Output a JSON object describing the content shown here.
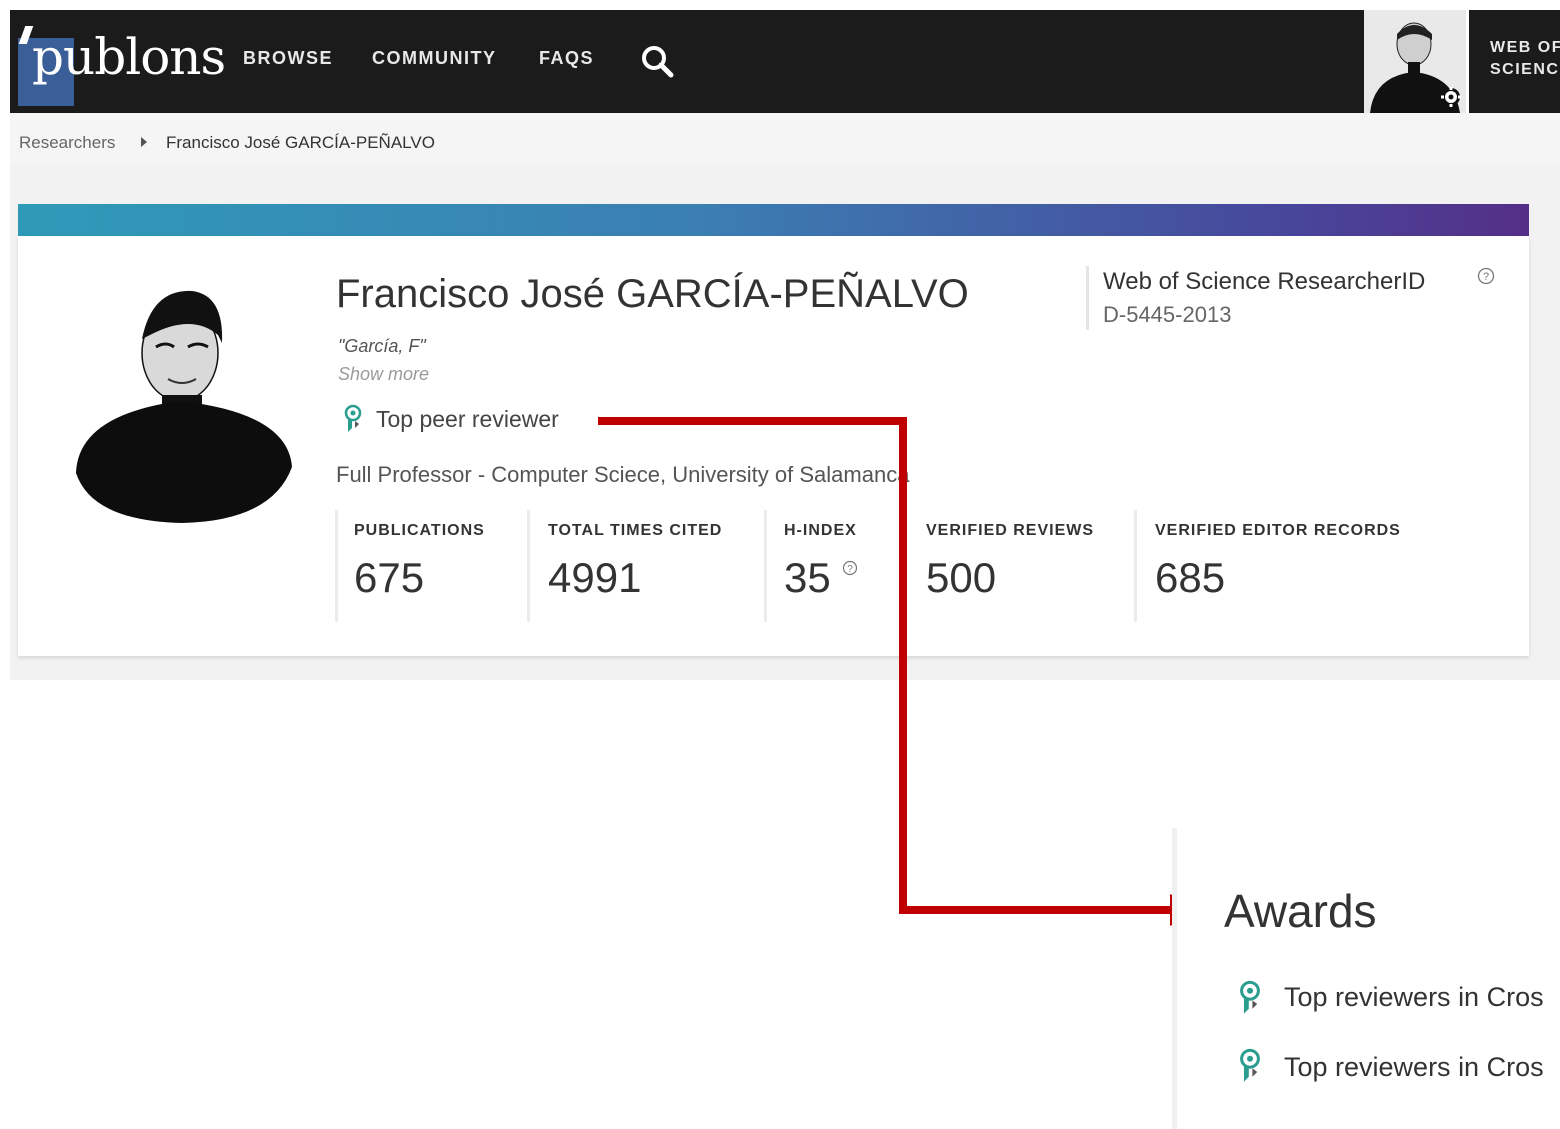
{
  "nav": {
    "logo": "publons",
    "items": [
      "BROWSE",
      "COMMUNITY",
      "FAQS"
    ],
    "wos_link": "WEB OF\nSCIENC"
  },
  "breadcrumb": {
    "parent": "Researchers",
    "current": "Francisco José GARCÍA-PEÑALVO"
  },
  "profile": {
    "name": "Francisco José GARCÍA-PEÑALVO",
    "alias": "\"García, F\"",
    "show_more": "Show more",
    "badge": "Top peer reviewer",
    "position": "Full Professor - Computer Sciece, University of Salamanca",
    "wos_title": "Web of Science ResearcherID",
    "wos_id": "D-5445-2013"
  },
  "metrics": [
    {
      "label": "PUBLICATIONS",
      "value": "675"
    },
    {
      "label": "TOTAL TIMES CITED",
      "value": "4991"
    },
    {
      "label": "H-INDEX",
      "value": "35"
    },
    {
      "label": "VERIFIED REVIEWS",
      "value": "500"
    },
    {
      "label": "VERIFIED EDITOR RECORDS",
      "value": "685"
    }
  ],
  "awards": {
    "title": "Awards",
    "items": [
      "Top reviewers in Cros",
      "Top reviewers in Cros"
    ]
  },
  "colors": {
    "nav_bg": "#1b1b1b",
    "gradient_start": "#2f9ab8",
    "gradient_end": "#552f87",
    "arrow": "#c00000",
    "award_green": "#2a9d8f"
  }
}
